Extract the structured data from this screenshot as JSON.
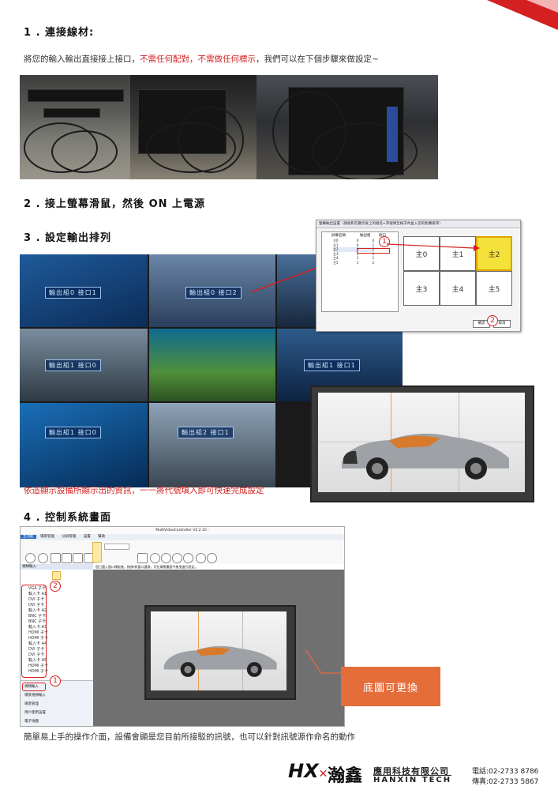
{
  "sections": [
    {
      "num": "1 .",
      "title": "連接線材:"
    },
    {
      "num": "2 .",
      "title": "接上螢幕滑鼠，然後 ON 上電源"
    },
    {
      "num": "3 .",
      "title": "設定輸出排列"
    },
    {
      "num": "4 .",
      "title": "控制系統畫面"
    }
  ],
  "intro": {
    "before": "將您的輸入輸出直接接上接口，",
    "red": "不需任何配對，不需做任何標示",
    "after": "，我們可以在下個步驟來做設定~"
  },
  "wall_labels": [
    "輸出組0 接口1",
    "輸出組0 接口2",
    "輸出組1 接口0",
    "輸出組1 接口1",
    "輸出組1 接口0",
    "輸出組2 接口1"
  ],
  "dialog": {
    "title": "螢幕輸出設置（請核對在顯示屏上的組名+序號填至格子內並入您的對應排序）",
    "col_headers": [
      "屏幕名稱",
      "輸出組",
      "接口"
    ],
    "rows": [
      [
        "主0",
        "0",
        "0"
      ],
      [
        "主1",
        "0",
        "1"
      ],
      [
        "主2",
        "0",
        "2"
      ],
      [
        "主3",
        "1",
        "0"
      ],
      [
        "主4",
        "1",
        "1"
      ],
      [
        "主5",
        "1",
        "2"
      ]
    ],
    "cells": [
      "主0",
      "主1",
      "主2",
      "主3",
      "主4",
      "主5"
    ],
    "ok_label": "確認",
    "cancel_label": "取消"
  },
  "caption3": "依造顯示設備所顯示出的資訊，一一將代號填入即可快速完成設定",
  "app": {
    "title": "MultiVideoController V2.2.10 -",
    "tabs": [
      "主功能",
      "場景管理",
      "分屏管理",
      "設置",
      "幫助"
    ],
    "panel_title": "視頻輸入",
    "tree": [
      "VGA 子卡",
      "輸入卡 A1",
      "DVI 子卡",
      "DVI 子卡",
      "輸入卡 A2",
      "BNC 子卡",
      "BNC 子卡",
      "輸入卡 A3",
      "HDMI 子卡",
      "HDMI 子卡",
      "輸入卡 A4",
      "DVI 子卡",
      "DVI 子卡",
      "輸入卡 A5",
      "HDMI 子卡",
      "HDMI 子卡"
    ],
    "bottom_menu": [
      "視頻輸入",
      "場景視頻輸入",
      "場景管理",
      "用戶使用設置",
      "電子地圖"
    ],
    "hint": "您已選入窗口模板後，拖移/新窗口選項，可在場景畫面中拖曳進行設定。"
  },
  "badges": [
    "1",
    "2"
  ],
  "orange_label": "底圖可更換",
  "caption4": "簡單易上手的操作介面，設備會顯是您目前所接駁的訊號，也可以針對訊號源作命名的動作",
  "footer": {
    "logo_mark": "HX",
    "logo_cn": "瀚鑫",
    "company_cn": "應用科技有限公司",
    "company_en": "HANXIN TECH",
    "phone": "電話:02-2733 8786",
    "fax": "傳真:02-2733 5867"
  },
  "colors": {
    "accent_red": "#d42020",
    "orange": "#e56d3a",
    "highlight_yellow": "#f4e23b"
  }
}
